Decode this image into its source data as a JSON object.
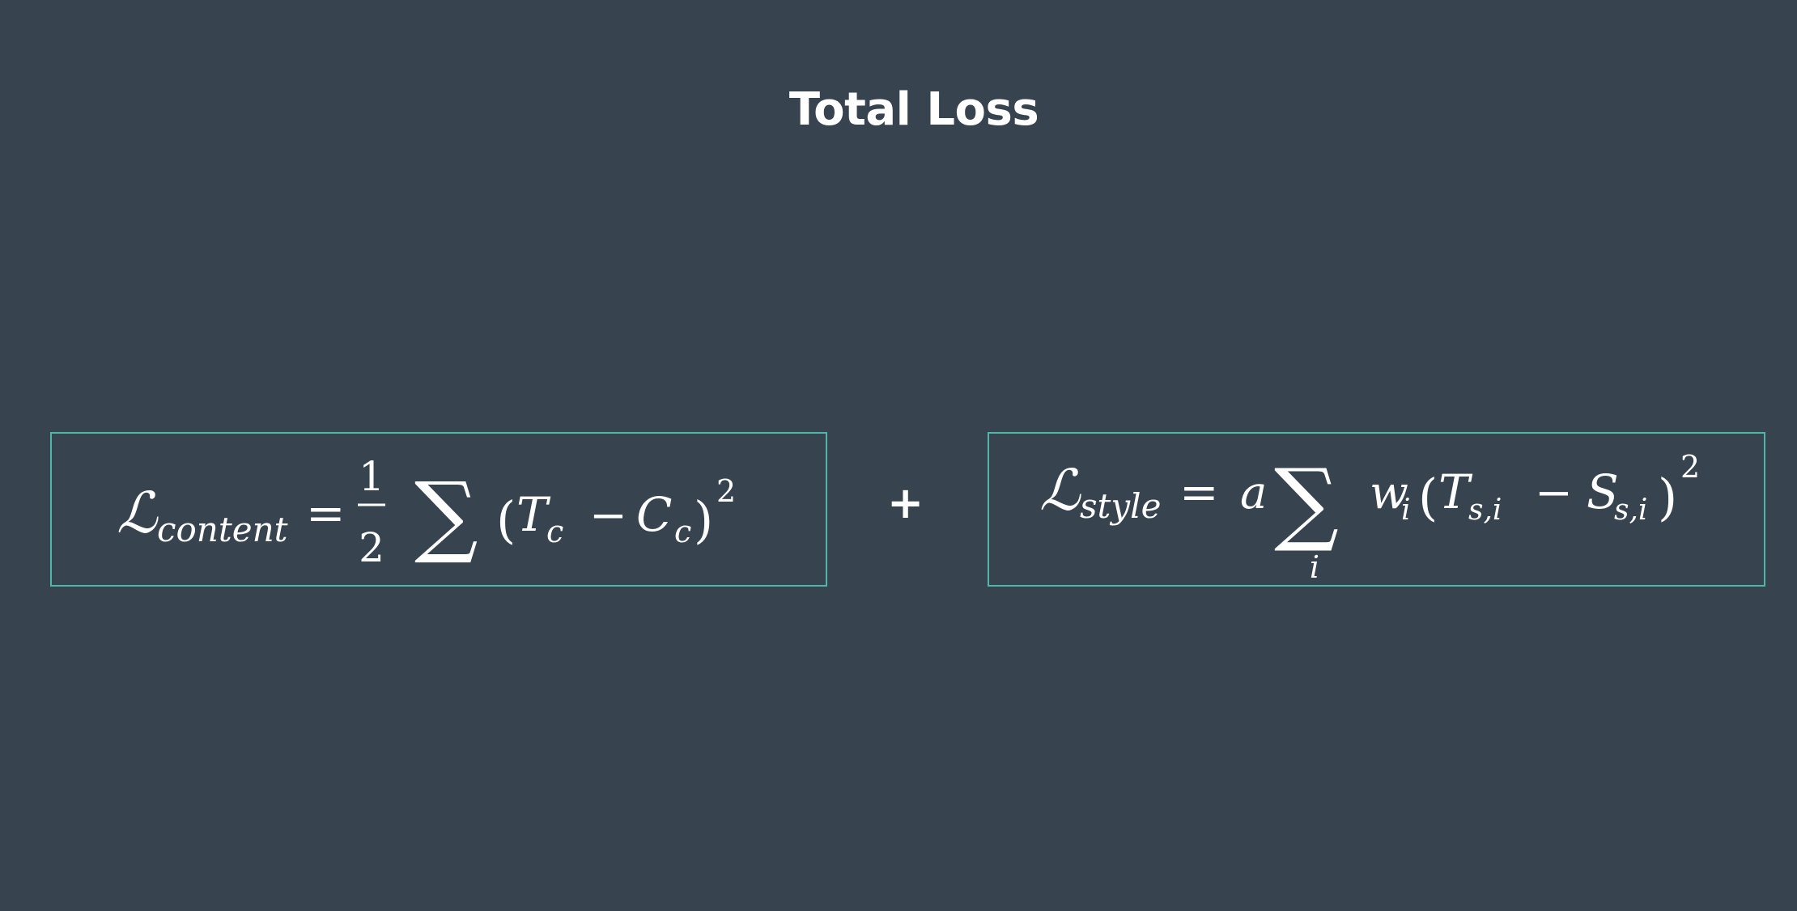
{
  "slide": {
    "title": "Total Loss",
    "operator": "+",
    "accent_color": "#4fb6a8",
    "background_color": "#37444f"
  },
  "content_loss": {
    "symbol": "ℒ",
    "subscript": "content",
    "equals": "=",
    "fraction_numerator": "1",
    "fraction_denominator": "2",
    "sum": "∑",
    "lparen": "(",
    "term_a": "T",
    "term_a_sub": "c",
    "minus": "−",
    "term_b": "C",
    "term_b_sub": "c",
    "rparen": ")",
    "exponent": "2"
  },
  "style_loss": {
    "symbol": "ℒ",
    "subscript": "style",
    "equals": "=",
    "coefficient": "a",
    "sum": "∑",
    "sum_index": "i",
    "weight": "w",
    "weight_sub": "i",
    "lparen": "(",
    "term_a": "T",
    "term_a_sub": "s,i",
    "minus": "−",
    "term_b": "S",
    "term_b_sub": "s,i",
    "rparen": ")",
    "exponent": "2"
  }
}
